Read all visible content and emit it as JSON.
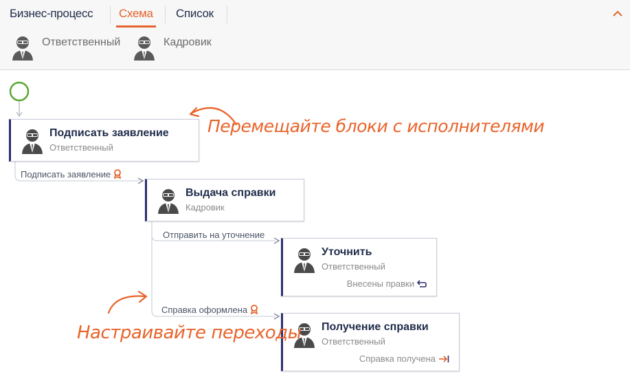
{
  "tabs": {
    "business_process": "Бизнес-процесс",
    "scheme": "Схема",
    "list": "Список"
  },
  "roles": [
    {
      "label": "Ответственный",
      "icon": "person-avatar-icon"
    },
    {
      "label": "Кадровик",
      "icon": "person-avatar-icon"
    }
  ],
  "blocks": {
    "sign": {
      "title": "Подписать заявление",
      "role": "Ответственный"
    },
    "issue": {
      "title": "Выдача справки",
      "role": "Кадровик"
    },
    "clarify": {
      "title": "Уточнить",
      "role": "Ответственный",
      "status": "Внесены правки"
    },
    "receive": {
      "title": "Получение справки",
      "role": "Ответственный",
      "status": "Справка получена"
    }
  },
  "transitions": {
    "sign": "Подписать заявление",
    "send_clarify": "Отправить на уточнение",
    "issued": "Справка оформлена"
  },
  "hints": {
    "move_blocks": "Перемещайте блоки с исполнителями",
    "setup_transitions": "Настраивайте переходы"
  },
  "colors": {
    "accent": "#e3632b",
    "hint": "#e8632a",
    "block_border": "#2c2f6e",
    "start_node": "#5aa832"
  }
}
